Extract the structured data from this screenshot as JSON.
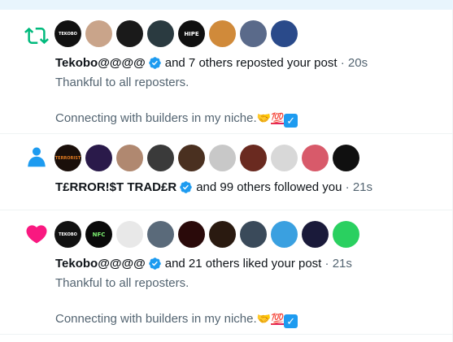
{
  "colors": {
    "accent_blue": "#1d9bf0",
    "repost_green": "#00ba7c",
    "like_pink": "#f91880",
    "text_primary": "#0f1419",
    "text_secondary": "#536471"
  },
  "notifications": [
    {
      "type": "repost",
      "icon": "repost-icon",
      "avatars": [
        {
          "label": "TEKOBO",
          "bg": "#111111",
          "fg": "#ffffff"
        },
        {
          "label": "",
          "bg": "#c9a48a",
          "fg": "#3a2a20"
        },
        {
          "label": "",
          "bg": "#1a1a1a",
          "fg": "#c08050"
        },
        {
          "label": "",
          "bg": "#2a3a40",
          "fg": "#9ab"
        },
        {
          "label": "HIPE",
          "bg": "#101010",
          "fg": "#ffffff"
        },
        {
          "label": "",
          "bg": "#d08a3a",
          "fg": "#3a2410"
        },
        {
          "label": "",
          "bg": "#5a6a8a",
          "fg": "#e8d8c8"
        },
        {
          "label": "",
          "bg": "#2a4a8a",
          "fg": "#e0c0a0"
        }
      ],
      "name": "Tekobo@@@@",
      "action": "and 7 others reposted your post",
      "separator": "·",
      "time": "20s",
      "post_lines": [
        "Thankful to all reposters.",
        "",
        "Connecting with builders in my niche."
      ],
      "post_emoji": {
        "handshake": "🤝",
        "hundred": "💯",
        "check": "✓"
      }
    },
    {
      "type": "follow",
      "icon": "person-icon",
      "avatars": [
        {
          "label": "TERRORIST",
          "bg": "#1a0f0a",
          "fg": "#e07a20"
        },
        {
          "label": "",
          "bg": "#2a1a4a",
          "fg": "#e040c0"
        },
        {
          "label": "",
          "bg": "#b08870",
          "fg": "#3a2a20"
        },
        {
          "label": "",
          "bg": "#3a3a3a",
          "fg": "#c0a080"
        },
        {
          "label": "",
          "bg": "#4a3020",
          "fg": "#e8c0a0"
        },
        {
          "label": "",
          "bg": "#c8c8c8",
          "fg": "#555"
        },
        {
          "label": "",
          "bg": "#6a2a20",
          "fg": "#e8c0a0"
        },
        {
          "label": "",
          "bg": "#d8d8d8",
          "fg": "#222"
        },
        {
          "label": "",
          "bg": "#d85a6a",
          "fg": "#f0d040"
        },
        {
          "label": "",
          "bg": "#101010",
          "fg": "#e0e0e0"
        }
      ],
      "name": "T£RROR!$T TRAD£R",
      "action": "and 99 others followed you",
      "separator": "·",
      "time": "21s"
    },
    {
      "type": "like",
      "icon": "heart-icon",
      "avatars": [
        {
          "label": "TEKOBO",
          "bg": "#111111",
          "fg": "#ffffff"
        },
        {
          "label": "NFC",
          "bg": "#0a0a0a",
          "fg": "#7cf070"
        },
        {
          "label": "",
          "bg": "#e8e8e8",
          "fg": "#333"
        },
        {
          "label": "",
          "bg": "#5a6a7a",
          "fg": "#e8d0b0"
        },
        {
          "label": "",
          "bg": "#2a0a0a",
          "fg": "#e04050"
        },
        {
          "label": "",
          "bg": "#2a1a10",
          "fg": "#c08060"
        },
        {
          "label": "",
          "bg": "#3a4a5a",
          "fg": "#e0e0e0"
        },
        {
          "label": "",
          "bg": "#3aa0e0",
          "fg": "#f0c030"
        },
        {
          "label": "",
          "bg": "#1a1a3a",
          "fg": "#8080c0"
        },
        {
          "label": "",
          "bg": "#2ad060",
          "fg": "#f04040"
        }
      ],
      "name": "Tekobo@@@@",
      "action": "and 21 others liked your post",
      "separator": "·",
      "time": "21s",
      "post_lines": [
        "Thankful to all reposters.",
        "",
        "Connecting with builders in my niche."
      ],
      "post_emoji": {
        "handshake": "🤝",
        "hundred": "💯",
        "check": "✓"
      }
    }
  ]
}
